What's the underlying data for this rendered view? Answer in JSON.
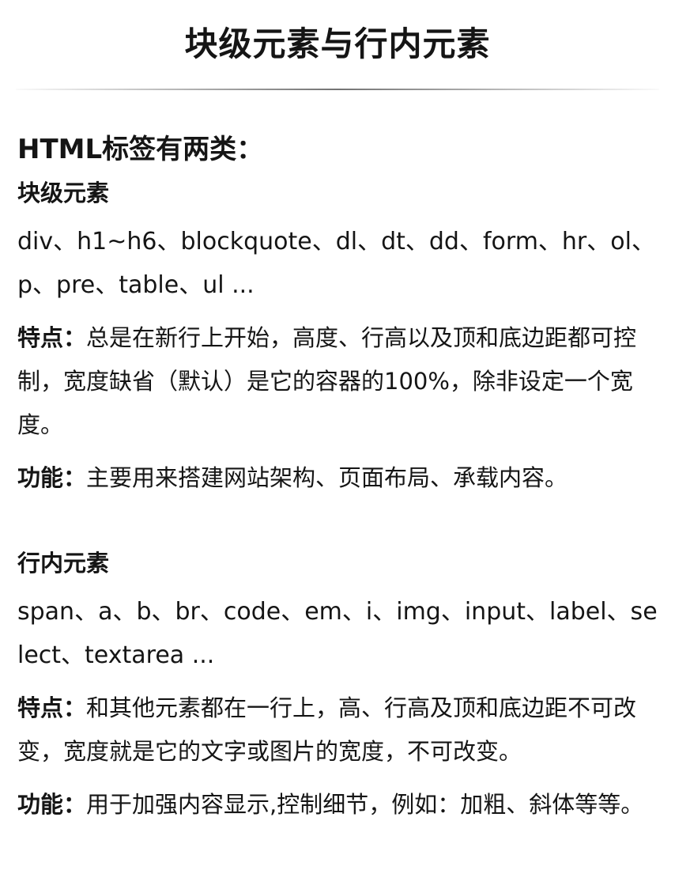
{
  "title": "块级元素与行内元素",
  "heading": "HTML标签有两类：",
  "block": {
    "title": "块级元素",
    "tags": "div、h1~h6、blockquote、dl、dt、dd、form、hr、ol、p、pre、table、ul ...",
    "feature_label": "特点：",
    "feature_text": "总是在新行上开始，高度、行高以及顶和底边距都可控制，宽度缺省（默认）是它的容器的100%，除非设定一个宽度。",
    "function_label": "功能：",
    "function_text": "主要用来搭建网站架构、页面布局、承载内容。"
  },
  "inline": {
    "title": "行内元素",
    "tags": "span、a、b、br、code、em、i、img、input、label、select、textarea ...",
    "feature_label": "特点：",
    "feature_text": "和其他元素都在一行上，高、行高及顶和底边距不可改变，宽度就是它的文字或图片的宽度，不可改变。",
    "function_label": "功能：",
    "function_text": "用于加强内容显示,控制细节，例如：加粗、斜体等等。"
  }
}
